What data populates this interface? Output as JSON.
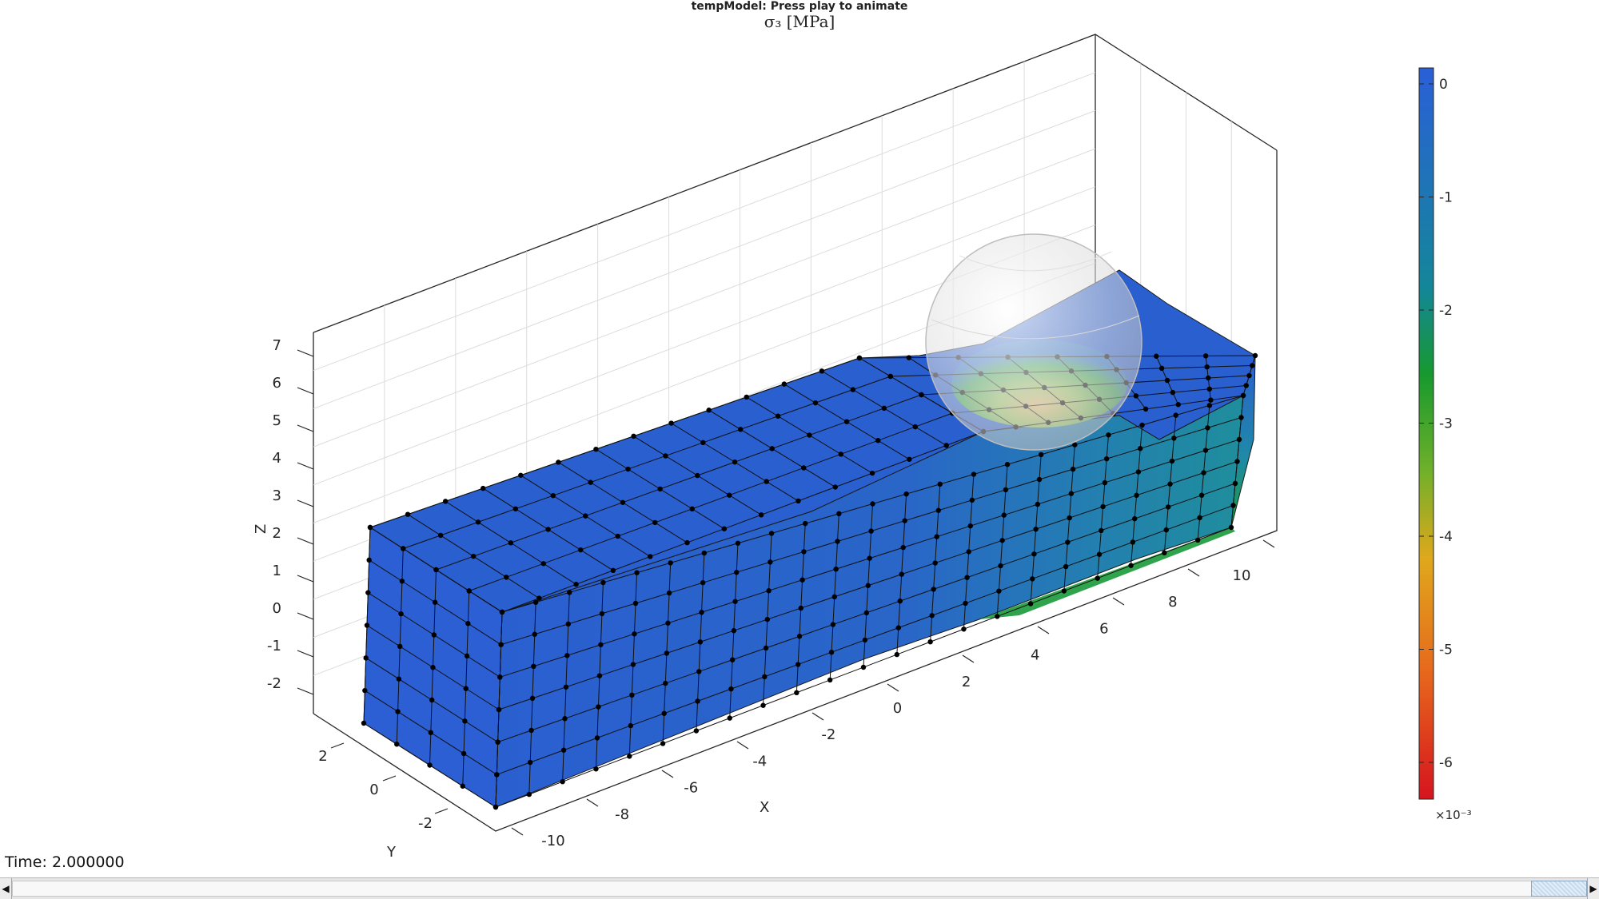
{
  "figure": {
    "title": "tempModel: Press play to animate",
    "subtitle": "σ₃ [MPa]"
  },
  "axes": {
    "x_label": "X",
    "y_label": "Y",
    "z_label": "Z",
    "x_ticks": [
      "-10",
      "-8",
      "-6",
      "-4",
      "-2",
      "0",
      "2",
      "4",
      "6",
      "8",
      "10"
    ],
    "y_ticks": [
      "2",
      "0",
      "-2"
    ],
    "z_ticks": [
      "7",
      "6",
      "5",
      "4",
      "3",
      "2",
      "1",
      "0",
      "-1",
      "-2"
    ],
    "grid": true
  },
  "colorbar": {
    "ticks": [
      "0",
      "-1",
      "-2",
      "-3",
      "-4",
      "-5",
      "-6"
    ],
    "exponent_label": "×10⁻³",
    "colors": [
      "#2a5fd0",
      "#177f9a",
      "#1a9a2e",
      "#8ab22a",
      "#e5a91c",
      "#e66a1c",
      "#d4141c"
    ]
  },
  "mesh": {
    "base_color": "#2a5fd0",
    "contact_color": "#e8c070",
    "indenter": "sphere"
  },
  "time": {
    "label": "Time: 2.000000"
  },
  "slider": {
    "left_arrow": "◀",
    "right_arrow": "▶"
  }
}
